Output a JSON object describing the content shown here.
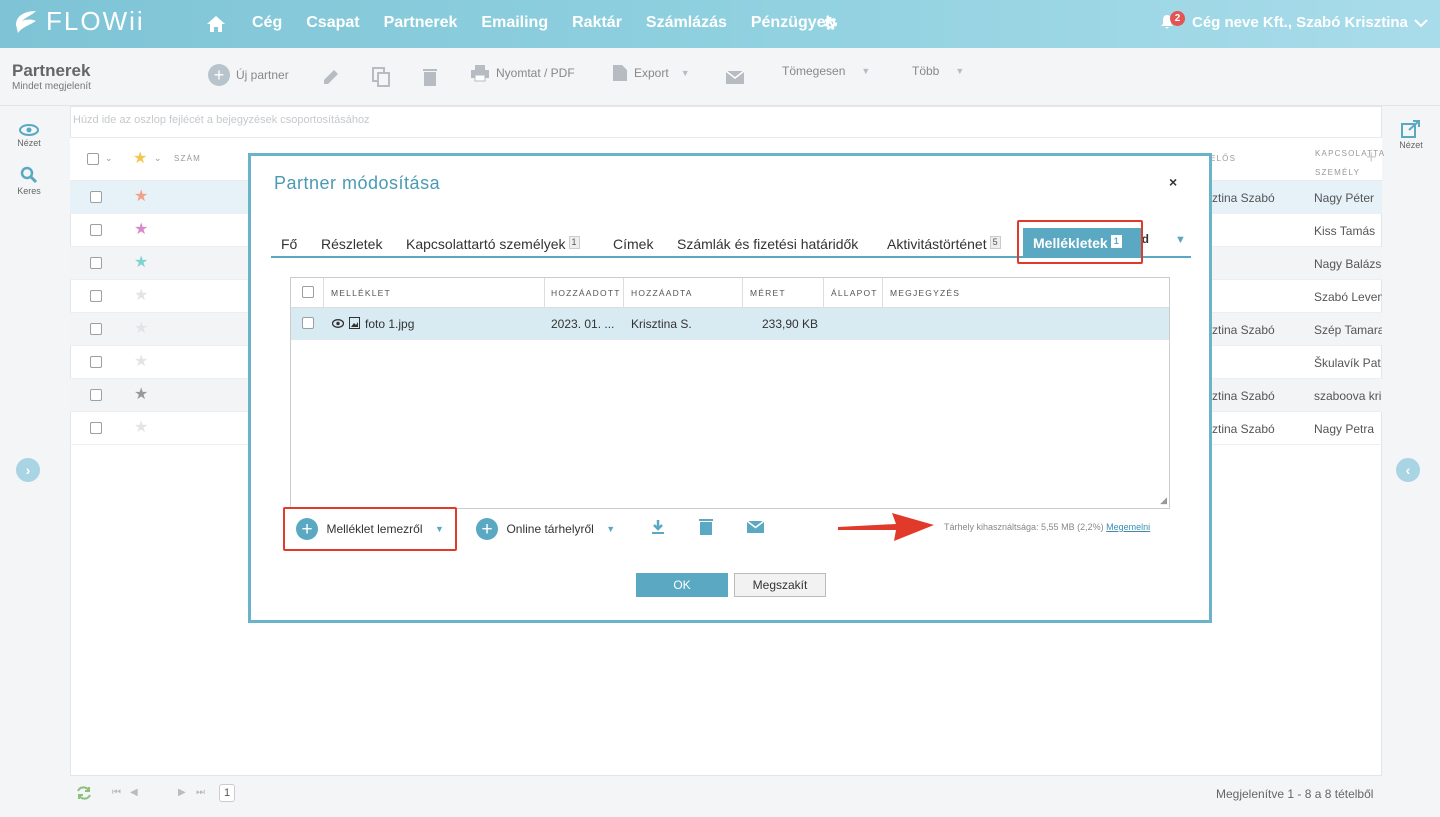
{
  "app": {
    "logo": "FLOWii",
    "nav": [
      "Cég",
      "Csapat",
      "Partnerek",
      "Emailing",
      "Raktár",
      "Számlázás",
      "Pénzügyek"
    ],
    "notifications": "2",
    "company": "Cég neve Kft., Szabó Krisztina"
  },
  "page": {
    "title": "Partnerek",
    "subtitle": "Mindet megjelenít"
  },
  "toolbar": {
    "new_partner": "Új partner",
    "print": "Nyomtat / PDF",
    "export": "Export",
    "bulk": "Tömegesen",
    "more": "Több"
  },
  "rail": {
    "view": "Nézet",
    "search": "Keres",
    "right_view": "Nézet"
  },
  "grid": {
    "group_hint": "Húzd ide az oszlop fejlécét a bejegyzések csoportosításához",
    "col_number": "Szám",
    "col_owner": "elős",
    "col_contact": "Kapcsolatta személy",
    "rows": [
      {
        "star_color": "#f2a08a",
        "owner": "sztina Szabó",
        "contact": "Nagy Péter"
      },
      {
        "star_color": "#d98ac8",
        "owner": "",
        "contact": "Kiss Tamás"
      },
      {
        "star_color": "#7fd3d0",
        "owner": "",
        "contact": "Nagy Balázs"
      },
      {
        "star_color": "#e2e4e7",
        "owner": "",
        "contact": "Szabó Leven"
      },
      {
        "star_color": "#e2e4e7",
        "owner": "sztina Szabó",
        "contact": "Szép Tamara"
      },
      {
        "star_color": "#e2e4e7",
        "owner": "",
        "contact": "Škulavík Pat"
      },
      {
        "star_color": "#999999",
        "owner": "sztina Szabó",
        "contact": "szaboova kri"
      },
      {
        "star_color": "#e2e4e7",
        "owner": "sztina Szabó",
        "contact": "Nagy Petra"
      }
    ],
    "page": "1",
    "shown": "Megjelenítve 1 - 8 a 8 tételből"
  },
  "modal": {
    "title": "Partner módosítása",
    "close": "×",
    "tabs": [
      {
        "label": "Fő"
      },
      {
        "label": "Részletek"
      },
      {
        "label": "Kapcsolattartó személyek",
        "badge": "1"
      },
      {
        "label": "Címek"
      },
      {
        "label": "Számlák és fizetési határidők"
      },
      {
        "label": "Aktivitástörténet",
        "badge": "5"
      }
    ],
    "active_tab": {
      "label": "Mellékletek",
      "badge": "1"
    },
    "hidden_tab": "zad",
    "attachments": {
      "columns": [
        "Melléklet",
        "Hozzáadott",
        "Hozzáadta",
        "Méret",
        "Állapot",
        "Megjegyzés"
      ],
      "rows": [
        {
          "name": "foto 1.jpg",
          "added": "2023. 01. ...",
          "added_by": "Krisztina S.",
          "size": "233,90 KB",
          "status": "",
          "note": ""
        }
      ]
    },
    "add_from_disk": "Melléklet lemezről",
    "add_online": "Online tárhelyről",
    "storage_text": "Tárhely kihasználtsága: 5,55 MB (2,2%)",
    "storage_link": "Megemelni",
    "ok": "OK",
    "cancel": "Megszakít"
  },
  "colors": {
    "accent": "#5aa8c2",
    "highlight": "#e23a2a"
  }
}
